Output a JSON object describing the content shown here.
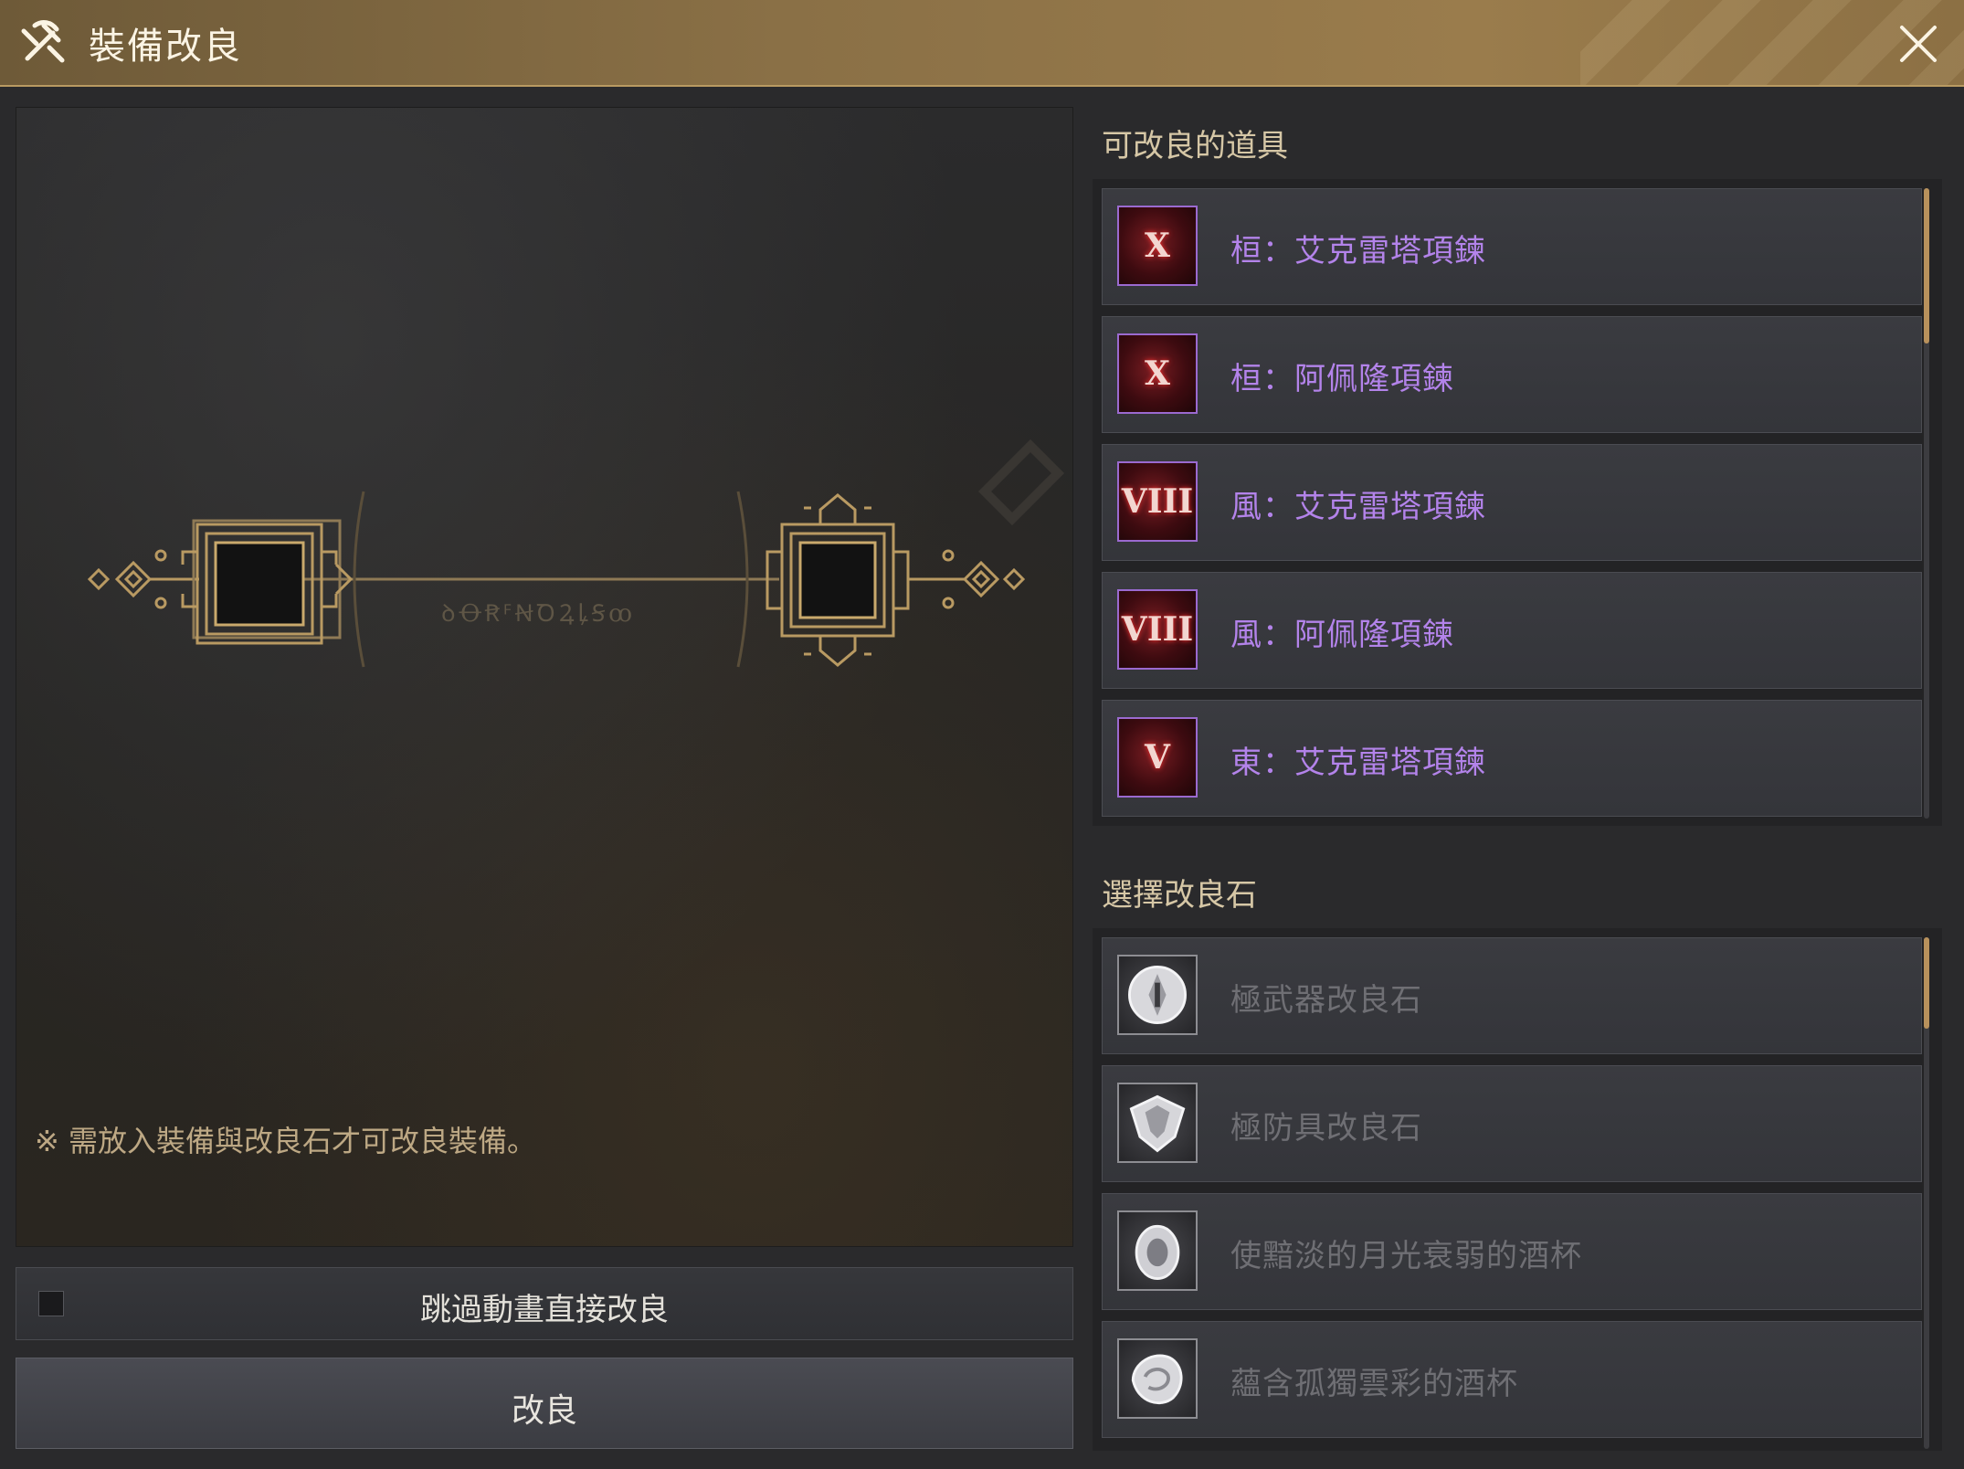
{
  "window": {
    "title": "裝備改良",
    "title_icon": "hammer-pick-icon",
    "close_icon": "close-icon"
  },
  "stage": {
    "rune_text": "ꝺꝊꞦꟳꞤꝹꝜꝲꞨꝏ",
    "notice": "※ 需放入裝備與改良石才可改良裝備。"
  },
  "controls": {
    "skip_animation_label": "跳過動畫直接改良",
    "skip_animation_checked": false,
    "refine_button_label": "改良"
  },
  "refinable_items": {
    "title": "可改良的道具",
    "items": [
      {
        "label": "桓：艾克雷塔項鍊",
        "roman": "X",
        "icon": "necklace-icon"
      },
      {
        "label": "桓：阿佩隆項鍊",
        "roman": "X",
        "icon": "necklace-icon"
      },
      {
        "label": "風：艾克雷塔項鍊",
        "roman": "VIII",
        "icon": "necklace-icon"
      },
      {
        "label": "風：阿佩隆項鍊",
        "roman": "VIII",
        "icon": "necklace-icon"
      },
      {
        "label": "東：艾克雷塔項鍊",
        "roman": "V",
        "icon": "necklace-icon"
      }
    ]
  },
  "refine_stones": {
    "title": "選擇改良石",
    "items": [
      {
        "label": "極武器改良石",
        "icon": "weapon-stone-icon"
      },
      {
        "label": "極防具改良石",
        "icon": "armor-stone-icon"
      },
      {
        "label": "使黯淡的月光衰弱的酒杯",
        "icon": "goblet-stone-icon"
      },
      {
        "label": "蘊含孤獨雲彩的酒杯",
        "icon": "cloud-stone-icon"
      }
    ]
  },
  "colors": {
    "title_bar": "#8a7046",
    "equipment_text": "#b383ea",
    "stone_text_disabled": "#6f6f74",
    "section_title": "#d6c7a6",
    "accent_gold": "#b8915c"
  }
}
